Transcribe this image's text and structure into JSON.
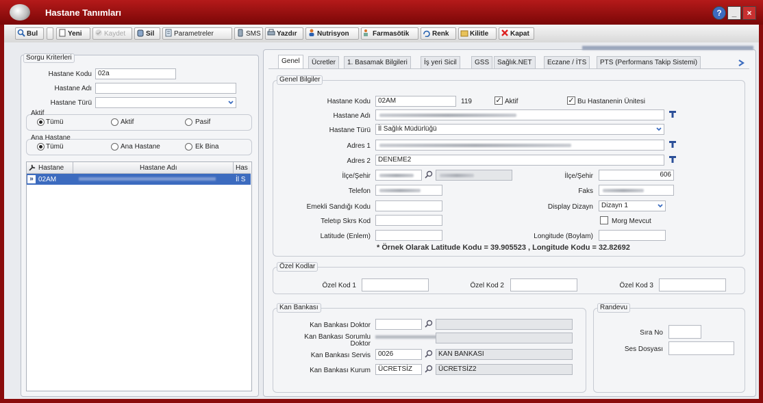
{
  "window": {
    "title": "Hastane Tanımları"
  },
  "toolbar": {
    "bul": "Bul",
    "yeni": "Yeni",
    "kaydet": "Kaydet",
    "sil": "Sil",
    "parametreler": "Parametreler",
    "sms": "SMS",
    "yazdir": "Yazdır",
    "nutrisyon": "Nutrisyon",
    "farmasotik": "Farmasötik",
    "renk": "Renk",
    "kilitle": "Kilitle",
    "kapat": "Kapat"
  },
  "sorgu": {
    "title": "Sorgu Kriterleri",
    "hastane_kodu_label": "Hastane Kodu",
    "hastane_kodu_value": "02a",
    "hastane_adi_label": "Hastane Adı",
    "hastane_turu_label": "Hastane Türü",
    "aktif_title": "Aktif",
    "aktif_options": [
      "Tümü",
      "Aktif",
      "Pasif"
    ],
    "ana_title": "Ana Hastane",
    "ana_options": [
      "Tümü",
      "Ana Hastane",
      "Ek Bina"
    ]
  },
  "grid": {
    "headers": [
      "Hastane",
      "Hastane Adı",
      "Has"
    ],
    "row": {
      "code": "02AM",
      "type": "İl S"
    }
  },
  "tabs": [
    "Genel",
    "Ücretler",
    "1. Basamak Bilgileri",
    "İş yeri Sicil",
    "GSS",
    "Sağlık.NET",
    "Eczane / İTS",
    "PTS (Performans Takip Sistemi)"
  ],
  "genel": {
    "title": "Genel Bilgiler",
    "hastane_kodu_label": "Hastane Kodu",
    "hastane_kodu_value": "02AM",
    "code_num": "119",
    "aktif_label": "Aktif",
    "unite_label": "Bu Hastanenin Ünitesi",
    "hastane_adi_label": "Hastane Adı",
    "hastane_turu_label": "Hastane Türü",
    "hastane_turu_value": "İl Sağlık Müdürlüğü",
    "adres1_label": "Adres 1",
    "adres2_label": "Adres 2",
    "adres2_value": "DENEME2",
    "ilce_label": "İlçe/Şehir",
    "ilce2_label": "İlçe/Şehir",
    "ilce2_value": "606",
    "telefon_label": "Telefon",
    "faks_label": "Faks",
    "emekli_label": "Emekli Sandığı Kodu",
    "display_label": "Display Dizayn",
    "display_value": "Dizayn 1",
    "teletip_label": "Teletıp Skrs Kod",
    "morg_label": "Morg Mevcut",
    "lat_label": "Latitude (Enlem)",
    "lon_label": "Longitude (Boylam)",
    "note": "* Örnek Olarak Latitude Kodu = 39.905523 , Longitude Kodu = 32.82692"
  },
  "ozel": {
    "title": "Özel Kodlar",
    "k1": "Özel Kod 1",
    "k2": "Özel Kod 2",
    "k3": "Özel Kod 3"
  },
  "kan": {
    "title": "Kan Bankası",
    "doktor_label": "Kan Bankası Doktor",
    "sorumlu_label_1": "Kan Bankası Sorumlu",
    "sorumlu_label_2": "Doktor",
    "servis_label": "Kan Bankası Servis",
    "servis_code": "0026",
    "servis_name": "KAN BANKASI",
    "kurum_label": "Kan Bankası Kurum",
    "kurum_code": "ÜCRETSİZ",
    "kurum_name": "ÜCRETSİZ2"
  },
  "randevu": {
    "title": "Randevu",
    "sira_label": "Sıra No",
    "ses_label": "Ses Dosyası"
  },
  "colors": {
    "titlebar": "#9b1010",
    "selection": "#3c6bbf",
    "tool_t": "#2b4f98"
  }
}
